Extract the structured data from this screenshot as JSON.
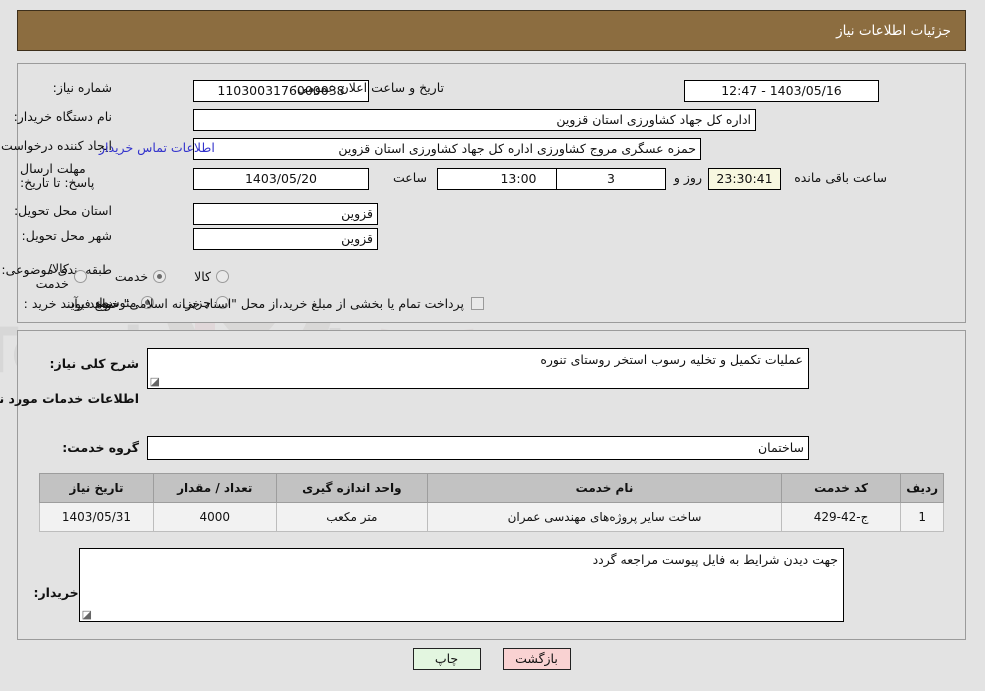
{
  "header": {
    "title": "جزئیات اطلاعات نیاز",
    "bar_color": "#8c6d40"
  },
  "top_section": {
    "need_number_label": "شماره نیاز:",
    "need_number_value": "1103003176000038",
    "public_announce_label": "تاریخ و ساعت اعلان عمومی:",
    "public_announce_value": "1403/05/16 - 12:47",
    "buyer_org_label": "نام دستگاه خریدار:",
    "buyer_org_value": "اداره کل جهاد کشاورزی استان قزوین",
    "requester_label": "ایجاد کننده درخواست:",
    "requester_value": "حمزه عسگری مروج کشاورزی اداره کل جهاد کشاورزی استان قزوین",
    "contact_link": "اطلاعات تماس خریدار",
    "deadline_label": "مهلت ارسال پاسخ: تا تاریخ:",
    "deadline_date": "1403/05/20",
    "hour_label": "ساعت",
    "hour_value": "13:00",
    "days_value": "3",
    "days_unit": "روز و",
    "countdown_value": "23:30:41",
    "countdown_unit": "ساعت باقی مانده",
    "province_label": "استان محل تحویل:",
    "province_value": "قزوین",
    "city_label": "شهر محل تحویل:",
    "city_value": "قزوین",
    "category_label": "طبقه بندی موضوعی:",
    "category_options": [
      {
        "label": "کالا",
        "selected": false
      },
      {
        "label": "خدمت",
        "selected": true
      },
      {
        "label": "کالا/خدمت",
        "selected": false
      }
    ],
    "process_label": "نوع فرآیند خرید :",
    "process_options": [
      {
        "label": "جزیی",
        "selected": false
      },
      {
        "label": "متوسط",
        "selected": true
      }
    ],
    "treasury_checkbox_label": "پرداخت تمام یا بخشی از مبلغ خرید،از محل \"اسناد خزانه اسلامی\" خواهد بود.",
    "treasury_checked": false
  },
  "bottom_section": {
    "general_desc_label": "شرح کلی نیاز:",
    "general_desc_value": "عملیات تکمیل و تخلیه رسوب استخر روستای تنوره",
    "services_heading": "اطلاعات خدمات مورد نیاز",
    "service_group_label": "گروه خدمت:",
    "service_group_value": "ساختمان",
    "buyer_notes_label": "توضیحات خریدار:",
    "buyer_notes_value": "جهت دیدن شرایط به فایل پیوست مراجعه گردد"
  },
  "table": {
    "headers": [
      "ردیف",
      "کد خدمت",
      "نام خدمت",
      "واحد اندازه گیری",
      "تعداد / مقدار",
      "تاریخ نیاز"
    ],
    "rows": [
      {
        "row_no": "1",
        "service_code": "ج-42-429",
        "service_name": "ساخت سایر پروژه‌های مهندسی عمران",
        "unit": "متر مکعب",
        "quantity": "4000",
        "need_date": "1403/05/31"
      }
    ]
  },
  "buttons": {
    "print": "چاپ",
    "back": "بازگشت"
  },
  "watermark": {
    "text": "AnaTender.net"
  }
}
